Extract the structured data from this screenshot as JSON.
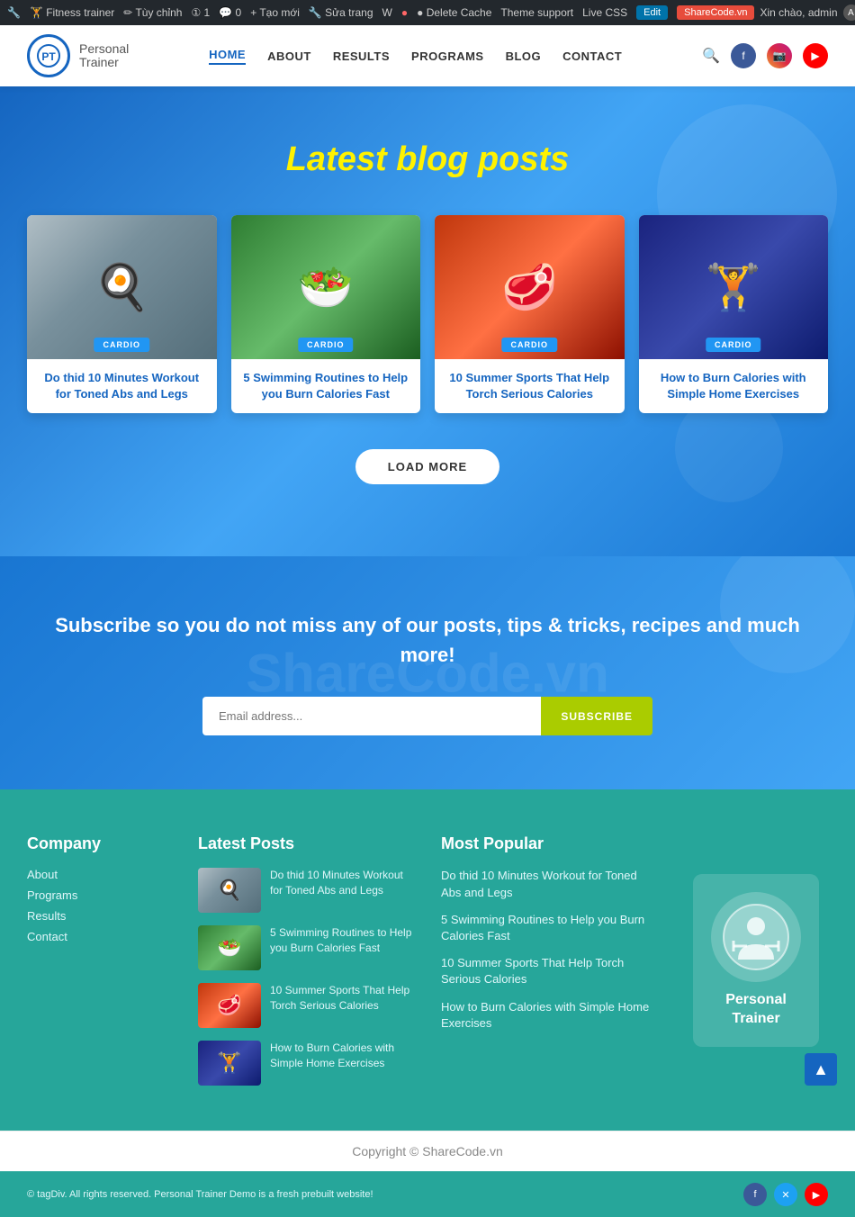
{
  "adminBar": {
    "items": [
      {
        "label": "🏋 Fitness trainer"
      },
      {
        "label": "✏ Tùy chỉnh"
      },
      {
        "label": "① 1"
      },
      {
        "label": "💬 0"
      },
      {
        "label": "+ Tạo mới"
      },
      {
        "label": "🔧 Sửa trang"
      },
      {
        "label": "W"
      },
      {
        "label": "● Delete Cache"
      },
      {
        "label": "Theme support"
      },
      {
        "label": "Live CSS"
      },
      {
        "label": "Edit"
      }
    ],
    "rightLabel": "Xin chào, admin",
    "sharecode": "ShareCode.vn"
  },
  "header": {
    "logoText": "Personal",
    "logoSub": "Trainer",
    "nav": [
      {
        "label": "HOME",
        "active": true
      },
      {
        "label": "ABOUT",
        "active": false
      },
      {
        "label": "RESULTS",
        "active": false
      },
      {
        "label": "PROGRAMS",
        "active": false
      },
      {
        "label": "BLOG",
        "active": false
      },
      {
        "label": "CONTACT",
        "active": false
      }
    ]
  },
  "blogSection": {
    "title": "Latest blog posts",
    "cards": [
      {
        "badge": "CARDIO",
        "title": "Do thid 10 Minutes Workout for Toned Abs and Legs",
        "imgEmoji": "🍳",
        "imgClass": "img-cooking"
      },
      {
        "badge": "CARDIO",
        "title": "5 Swimming Routines to Help you Burn Calories Fast",
        "imgEmoji": "🥗",
        "imgClass": "img-salad"
      },
      {
        "badge": "CARDIO",
        "title": "10 Summer Sports That Help Torch Serious Calories",
        "imgEmoji": "🥩",
        "imgClass": "img-steak"
      },
      {
        "badge": "CARDIO",
        "title": "How to Burn Calories with Simple Home Exercises",
        "imgEmoji": "🏋",
        "imgClass": "img-gym"
      }
    ],
    "loadMoreLabel": "LOAD MORE"
  },
  "subscribeSection": {
    "title": "Subscribe so you do not miss any of our posts, tips & tricks, recipes and much more!",
    "placeholder": "Email address...",
    "buttonLabel": "SUBSCRIBE",
    "watermark": "ShareCode.vn"
  },
  "footer": {
    "company": {
      "heading": "Company",
      "links": [
        {
          "label": "About"
        },
        {
          "label": "Programs"
        },
        {
          "label": "Results"
        },
        {
          "label": "Contact"
        }
      ]
    },
    "latestPosts": {
      "heading": "Latest Posts",
      "posts": [
        {
          "title": "Do thid 10 Minutes Workout for Toned Abs and Legs",
          "imgEmoji": "🍳",
          "imgClass": "img-cooking"
        },
        {
          "title": "5 Swimming Routines to Help you Burn Calories Fast",
          "imgEmoji": "🥗",
          "imgClass": "img-salad"
        },
        {
          "title": "10 Summer Sports That Help Torch Serious Calories",
          "imgEmoji": "🥩",
          "imgClass": "img-steak"
        },
        {
          "title": "How to Burn Calories with Simple Home Exercises",
          "imgEmoji": "🏋",
          "imgClass": "img-gym"
        }
      ]
    },
    "mostPopular": {
      "heading": "Most Popular",
      "items": [
        {
          "label": "Do thid 10 Minutes Workout for Toned Abs and Legs"
        },
        {
          "label": "5 Swimming Routines to Help you Burn Calories Fast"
        },
        {
          "label": "10 Summer Sports That Help Torch Serious Calories"
        },
        {
          "label": "How to Burn Calories with Simple Home Exercises"
        }
      ]
    },
    "logo": {
      "text": "Personal\nTrainer"
    }
  },
  "copyright": {
    "text": "Copyright © ShareCode.vn"
  },
  "footerBottom": {
    "text": "© tagDiv. All rights reserved. Personal Trainer Demo is a fresh prebuilt website!"
  }
}
